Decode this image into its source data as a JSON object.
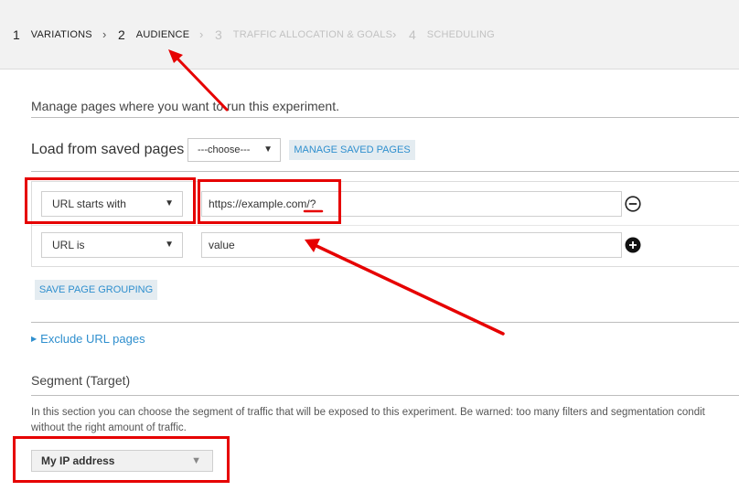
{
  "stepper": {
    "steps": [
      {
        "number": "1",
        "label": "VARIATIONS"
      },
      {
        "number": "2",
        "label": "AUDIENCE"
      },
      {
        "number": "3",
        "label": "TRAFFIC ALLOCATION & GOALS"
      },
      {
        "number": "4",
        "label": "SCHEDULING"
      }
    ],
    "separator": "›"
  },
  "pages": {
    "title": "Manage pages where you want to run this experiment.",
    "load_label": "Load from saved pages",
    "choose_value": "---choose---",
    "manage_button": "MANAGE SAVED PAGES",
    "rules": [
      {
        "operator": "URL starts with",
        "value": "https://example.com/?",
        "placeholder": ""
      },
      {
        "operator": "URL is",
        "value": "",
        "placeholder": "value"
      }
    ],
    "save_grouping_button": "SAVE PAGE GROUPING",
    "exclude_link": "Exclude URL pages"
  },
  "segment": {
    "title": "Segment (Target)",
    "description_line1": "In this section you can choose the segment of traffic that will be exposed to this experiment. Be warned: too many filters and segmentation condit",
    "description_line2": "without the right amount of traffic.",
    "selected": "My IP address"
  },
  "colors": {
    "accent": "#2f8fce",
    "annotation": "#e60000"
  }
}
